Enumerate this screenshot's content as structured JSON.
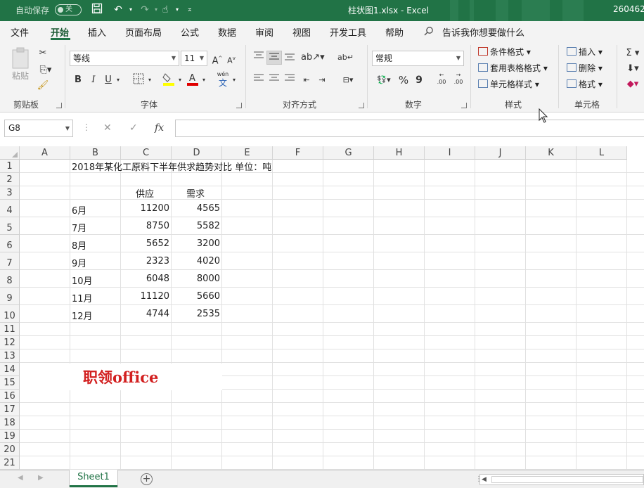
{
  "titlebar": {
    "autosave_label": "自动保存",
    "autosave_state": "关",
    "doc_title": "柱状图1.xlsx  -  Excel",
    "user_id": "260462",
    "accent": "#217346"
  },
  "menu": {
    "tabs": [
      "文件",
      "开始",
      "插入",
      "页面布局",
      "公式",
      "数据",
      "审阅",
      "视图",
      "开发工具",
      "帮助"
    ],
    "active": "开始",
    "tell_me": "告诉我你想要做什么"
  },
  "ribbon": {
    "clipboard": {
      "paste_label": "粘贴",
      "group_label": "剪贴板"
    },
    "font": {
      "font_name": "等线",
      "font_size": "11",
      "bold": "B",
      "italic": "I",
      "underline": "U",
      "wen": "wén",
      "wen_char": "文",
      "grow": "A",
      "shrink": "A",
      "group_label": "字体"
    },
    "alignment": {
      "group_label": "对齐方式",
      "wrap": "ab"
    },
    "number": {
      "format": "常规",
      "percent": "%",
      "comma": "9",
      "inc_decimal": ".00",
      "dec_decimal": ".00",
      "group_label": "数字"
    },
    "styles": {
      "conditional": "条件格式",
      "table": "套用表格格式",
      "cell_styles": "单元格样式",
      "group_label": "样式"
    },
    "cells": {
      "insert": "插入",
      "delete": "删除",
      "format": "格式",
      "group_label": "单元格"
    },
    "editing": {
      "sigma": "Σ"
    }
  },
  "formula_bar": {
    "name_box": "G8",
    "fx": "fx",
    "formula": ""
  },
  "grid": {
    "columns": [
      "A",
      "B",
      "C",
      "D",
      "E",
      "F",
      "G",
      "H",
      "I",
      "J",
      "K",
      "L"
    ],
    "rows": [
      "1",
      "2",
      "3",
      "4",
      "5",
      "6",
      "7",
      "8",
      "9",
      "10",
      "11",
      "12",
      "13",
      "14",
      "15",
      "16",
      "17",
      "18",
      "19",
      "20",
      "21"
    ],
    "title": "2018年某化工原料下半年供求趋势对比 单位：吨",
    "header_supply": "供应",
    "header_demand": "需求",
    "data": [
      {
        "month": "6月",
        "supply": "11200",
        "demand": "4565"
      },
      {
        "month": "7月",
        "supply": "8750",
        "demand": "5582"
      },
      {
        "month": "8月",
        "supply": "5652",
        "demand": "3200"
      },
      {
        "month": "9月",
        "supply": "2323",
        "demand": "4020"
      },
      {
        "month": "10月",
        "supply": "6048",
        "demand": "8000"
      },
      {
        "month": "11月",
        "supply": "11120",
        "demand": "5660"
      },
      {
        "month": "12月",
        "supply": "4744",
        "demand": "2535"
      }
    ],
    "watermark": "职领office"
  },
  "sheets": {
    "tabs": [
      "Sheet1"
    ],
    "active": "Sheet1",
    "add": "+"
  }
}
